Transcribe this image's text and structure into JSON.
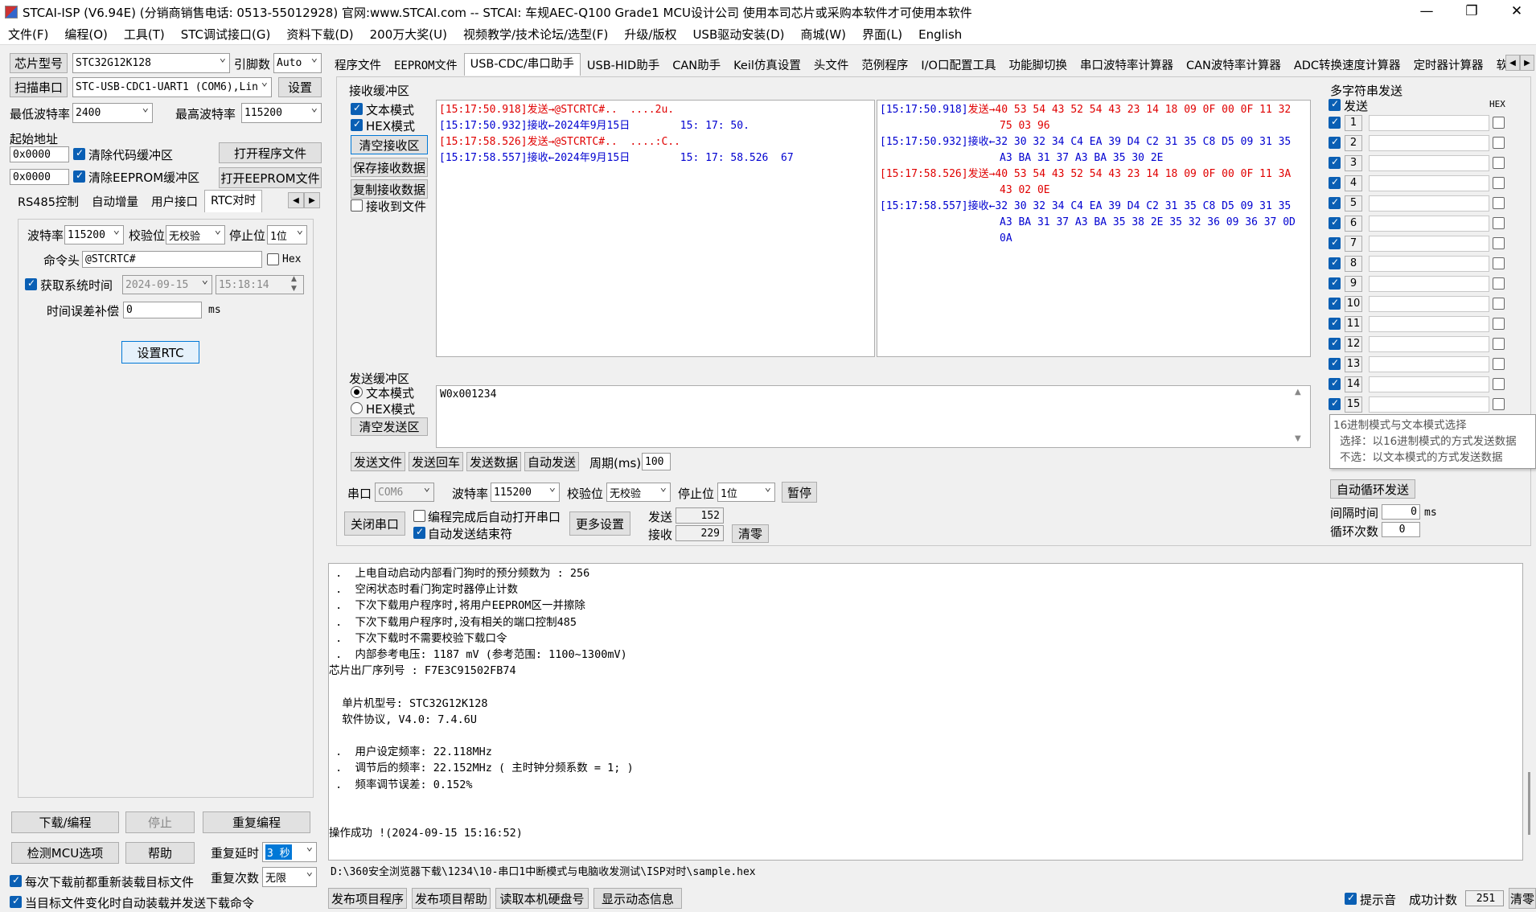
{
  "window": {
    "title": "STCAI-ISP (V6.94E) (分销商销售电话: 0513-55012928) 官网:www.STCAI.com  -- STCAI: 车规AEC-Q100 Grade1 MCU设计公司 使用本司芯片或采购本软件才可使用本软件",
    "min": "—",
    "max": "❐",
    "close": "✕"
  },
  "menu": [
    "文件(F)",
    "编程(O)",
    "工具(T)",
    "STC调试接口(G)",
    "资料下载(D)",
    "200万大奖(U)",
    "视频教学/技术论坛/选型(F)",
    "升级/版权",
    "USB驱动安装(D)",
    "商城(W)",
    "界面(L)",
    "English"
  ],
  "left": {
    "chip_label": "芯片型号",
    "chip_value": "STC32G12K128",
    "pins_label": "引脚数",
    "pins_value": "Auto",
    "scan_label": "扫描串口",
    "port_value": "STC-USB-CDC1-UART1 (COM6),Lin",
    "settings_btn": "设置",
    "min_baud_label": "最低波特率",
    "min_baud": "2400",
    "max_baud_label": "最高波特率",
    "max_baud": "115200",
    "start_addr_label": "起始地址",
    "addr1": "0x0000",
    "clear_code": "清除代码缓冲区",
    "open_prog": "打开程序文件",
    "addr2": "0x0000",
    "clear_eeprom": "清除EEPROM缓冲区",
    "open_eeprom": "打开EEPROM文件",
    "tabs": [
      "RS485控制",
      "自动增量",
      "用户接口",
      "RTC对时"
    ],
    "rtc": {
      "baud_label": "波特率",
      "baud": "115200",
      "parity_label": "校验位",
      "parity": "无校验",
      "stop_label": "停止位",
      "stop": "1位",
      "cmd_label": "命令头",
      "cmd": "@STCRTC#",
      "hex": "Hex",
      "sys_time_label": "获取系统时间",
      "date": "2024-09-15",
      "time": "15:18:14",
      "comp_label": "时间误差补偿",
      "comp": "0",
      "comp_unit": "ms",
      "set_btn": "设置RTC"
    },
    "download_btn": "下载/编程",
    "stop_btn": "停止",
    "reprog_btn": "重复编程",
    "detect_btn": "检测MCU选项",
    "help_btn": "帮助",
    "delay_label": "重复延时",
    "delay": "3 秒",
    "count_label": "重复次数",
    "count": "无限",
    "reload_label": "每次下载前都重新装载目标文件",
    "autosend_label": "当目标文件变化时自动装载并发送下载命令"
  },
  "tabs": [
    "程序文件",
    "EEPROM文件",
    "USB-CDC/串口助手",
    "USB-HID助手",
    "CAN助手",
    "Keil仿真设置",
    "头文件",
    "范例程序",
    "I/O口配置工具",
    "功能脚切换",
    "串口波特率计算器",
    "CAN波特率计算器",
    "ADC转换速度计算器",
    "定时器计算器",
    "软件延"
  ],
  "rx": {
    "group": "接收缓冲区",
    "text_mode": "文本模式",
    "hex_mode": "HEX模式",
    "clear_btn": "清空接收区",
    "save_btn": "保存接收数据",
    "copy_btn": "复制接收数据",
    "to_file": "接收到文件",
    "text_lines": [
      {
        "ts": "[15:17:50.918]",
        "dir": "发送→",
        "body": "@STCRTC#..  ....2u.",
        "kind": "send"
      },
      {
        "ts": "[15:17:50.932]",
        "dir": "接收←",
        "body": "2024年9月15日        15: 17: 50.",
        "kind": "recv"
      },
      {
        "ts": "[15:17:58.526]",
        "dir": "发送→",
        "body": "@STCRTC#..  ....:C..",
        "kind": "send"
      },
      {
        "ts": "[15:17:58.557]",
        "dir": "接收←",
        "body": "2024年9月15日        15: 17: 58.526  67",
        "kind": "recv"
      }
    ],
    "hex_lines": [
      {
        "ts": "[15:17:50.918]",
        "dir": "发送→",
        "body": "40 53 54 43 52 54 43 23 14 18 09 0F 00 0F 11 32",
        "kind": "send"
      },
      {
        "ts": "",
        "dir": "",
        "body": "75 03 96",
        "kind": "send"
      },
      {
        "ts": "[15:17:50.932]",
        "dir": "接收←",
        "body": "32 30 32 34 C4 EA 39 D4 C2 31 35 C8 D5 09 31 35",
        "kind": "recv"
      },
      {
        "ts": "",
        "dir": "",
        "body": "A3 BA 31 37 A3 BA 35 30 2E",
        "kind": "recv"
      },
      {
        "ts": "[15:17:58.526]",
        "dir": "发送→",
        "body": "40 53 54 43 52 54 43 23 14 18 09 0F 00 0F 11 3A",
        "kind": "send"
      },
      {
        "ts": "",
        "dir": "",
        "body": "43 02 0E",
        "kind": "send"
      },
      {
        "ts": "[15:17:58.557]",
        "dir": "接收←",
        "body": "32 30 32 34 C4 EA 39 D4 C2 31 35 C8 D5 09 31 35",
        "kind": "recv"
      },
      {
        "ts": "",
        "dir": "",
        "body": "A3 BA 31 37 A3 BA 35 38 2E 35 32 36 09 36 37 0D",
        "kind": "recv"
      },
      {
        "ts": "",
        "dir": "",
        "body": "0A",
        "kind": "recv"
      }
    ]
  },
  "tx": {
    "group": "发送缓冲区",
    "text_mode": "文本模式",
    "hex_mode": "HEX模式",
    "clear_btn": "清空发送区",
    "content": "W0x001234",
    "send_file": "发送文件",
    "send_cr": "发送回车",
    "send_data": "发送数据",
    "auto_send": "自动发送",
    "period_label": "周期(ms)",
    "period": "100"
  },
  "port": {
    "label": "串口",
    "value": "COM6",
    "baud_label": "波特率",
    "baud": "115200",
    "parity_label": "校验位",
    "parity": "无校验",
    "stop_label": "停止位",
    "stop": "1位",
    "pause_btn": "暂停",
    "close_btn": "关闭串口",
    "auto_open": "编程完成后自动打开串口",
    "auto_end": "自动发送结束符",
    "more_btn": "更多设置",
    "sent_label": "发送",
    "sent": "152",
    "recv_label": "接收",
    "recv": "229",
    "clear_btn": "清零"
  },
  "multi": {
    "title": "多字符串发送",
    "send_label": "发送",
    "hex_label": "HEX",
    "rows": [
      "1",
      "2",
      "3",
      "4",
      "5",
      "6",
      "7",
      "8",
      "9",
      "10",
      "11",
      "12",
      "13",
      "14",
      "15"
    ],
    "tooltip": [
      "16进制模式与文本模式选择",
      "选择：以16进制模式的方式发送数据",
      "不选：以文本模式的方式发送数据"
    ],
    "auto_loop": "自动循环发送",
    "interval_label": "间隔时间",
    "interval": "0",
    "interval_unit": "ms",
    "loop_label": "循环次数",
    "loop": "0"
  },
  "log": {
    "lines": [
      " .  上电自动启动内部看门狗时的预分频数为 : 256",
      " .  空闲状态时看门狗定时器停止计数",
      " .  下次下载用户程序时,将用户EEPROM区一并擦除",
      " .  下次下载用户程序时,没有相关的端口控制485",
      " .  下次下载时不需要校验下载口令",
      " .  内部参考电压: 1187 mV (参考范围: 1100~1300mV)",
      "芯片出厂序列号 : F7E3C91502FB74",
      "",
      "  单片机型号: STC32G12K128",
      "  软件协议, V4.0: 7.4.6U",
      "",
      " .  用户设定频率: 22.118MHz",
      " .  调节后的频率: 22.152MHz ( 主时钟分频系数 = 1; )",
      " .  频率调节误差: 0.152%",
      "",
      "",
      "操作成功 !(2024-09-15 15:16:52)"
    ],
    "path": "D:\\360安全浏览器下载\\1234\\10-串口1中断模式与电脑收发测试\\ISP对时\\sample.hex"
  },
  "bottom": {
    "publish_btn": "发布项目程序",
    "publish_help_btn": "发布项目帮助",
    "disk_btn": "读取本机硬盘号",
    "dyn_btn": "显示动态信息",
    "beep_label": "提示音",
    "success_label": "成功计数",
    "success": "251",
    "clear_btn": "清零"
  }
}
